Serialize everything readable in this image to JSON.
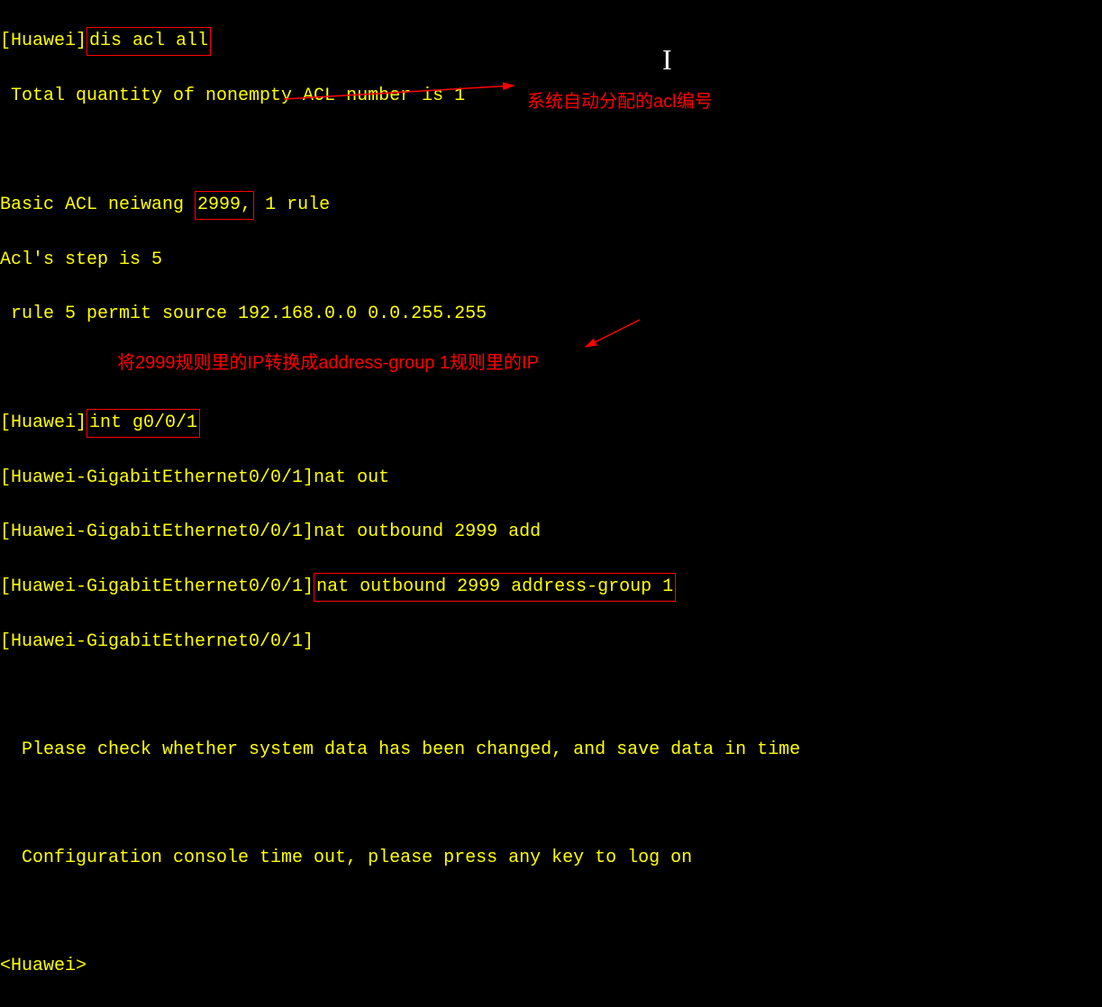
{
  "lines": {
    "l1_prompt": "[Huawei]",
    "l1_cmd": "dis acl all",
    "l2": " Total quantity of nonempty ACL number is 1",
    "l3_a": "Basic ACL neiwang ",
    "l3_b": "2999,",
    "l3_c": " 1 rule",
    "l4": "Acl's step is 5",
    "l5": " rule 5 permit source 192.168.0.0 0.0.255.255",
    "l6_prompt": "[Huawei]",
    "l6_cmd": "int g0/0/1",
    "l7": "[Huawei-GigabitEthernet0/0/1]nat out",
    "l8": "[Huawei-GigabitEthernet0/0/1]nat outbound 2999 add",
    "l9_a": "[Huawei-GigabitEthernet0/0/1]",
    "l9_b": "nat outbound 2999 address-group 1",
    "l10": "[Huawei-GigabitEthernet0/0/1]",
    "l11": "  Please check whether system data has been changed, and save data in time",
    "l12": "  Configuration console time out, please press any key to log on",
    "l13": "<Huawei>"
  },
  "annotations": {
    "a1": "系统自动分配的acl编号",
    "a2": "将2999规则里的IP转换成address-group 1规则里的IP"
  },
  "cursor": "I"
}
